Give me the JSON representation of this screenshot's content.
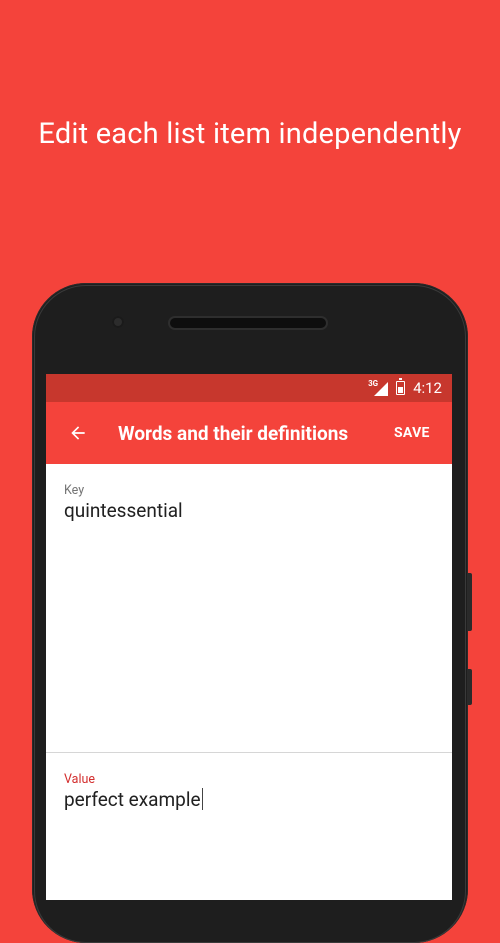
{
  "promo": {
    "headline": "Edit each list item independently"
  },
  "status_bar": {
    "network_type": "3G",
    "time": "4:12",
    "icons": [
      "signal-icon",
      "battery-charging-icon"
    ]
  },
  "app_bar": {
    "back_icon": "arrow-back-icon",
    "title": "Words and their definitions",
    "save_label": "SAVE"
  },
  "form": {
    "key": {
      "label": "Key",
      "value": "quintessential"
    },
    "value": {
      "label": "Value",
      "value": "perfect example"
    }
  },
  "colors": {
    "brand_red": "#f4433b",
    "status_bar_red": "#c7372d",
    "active_label": "#d32f2f"
  }
}
